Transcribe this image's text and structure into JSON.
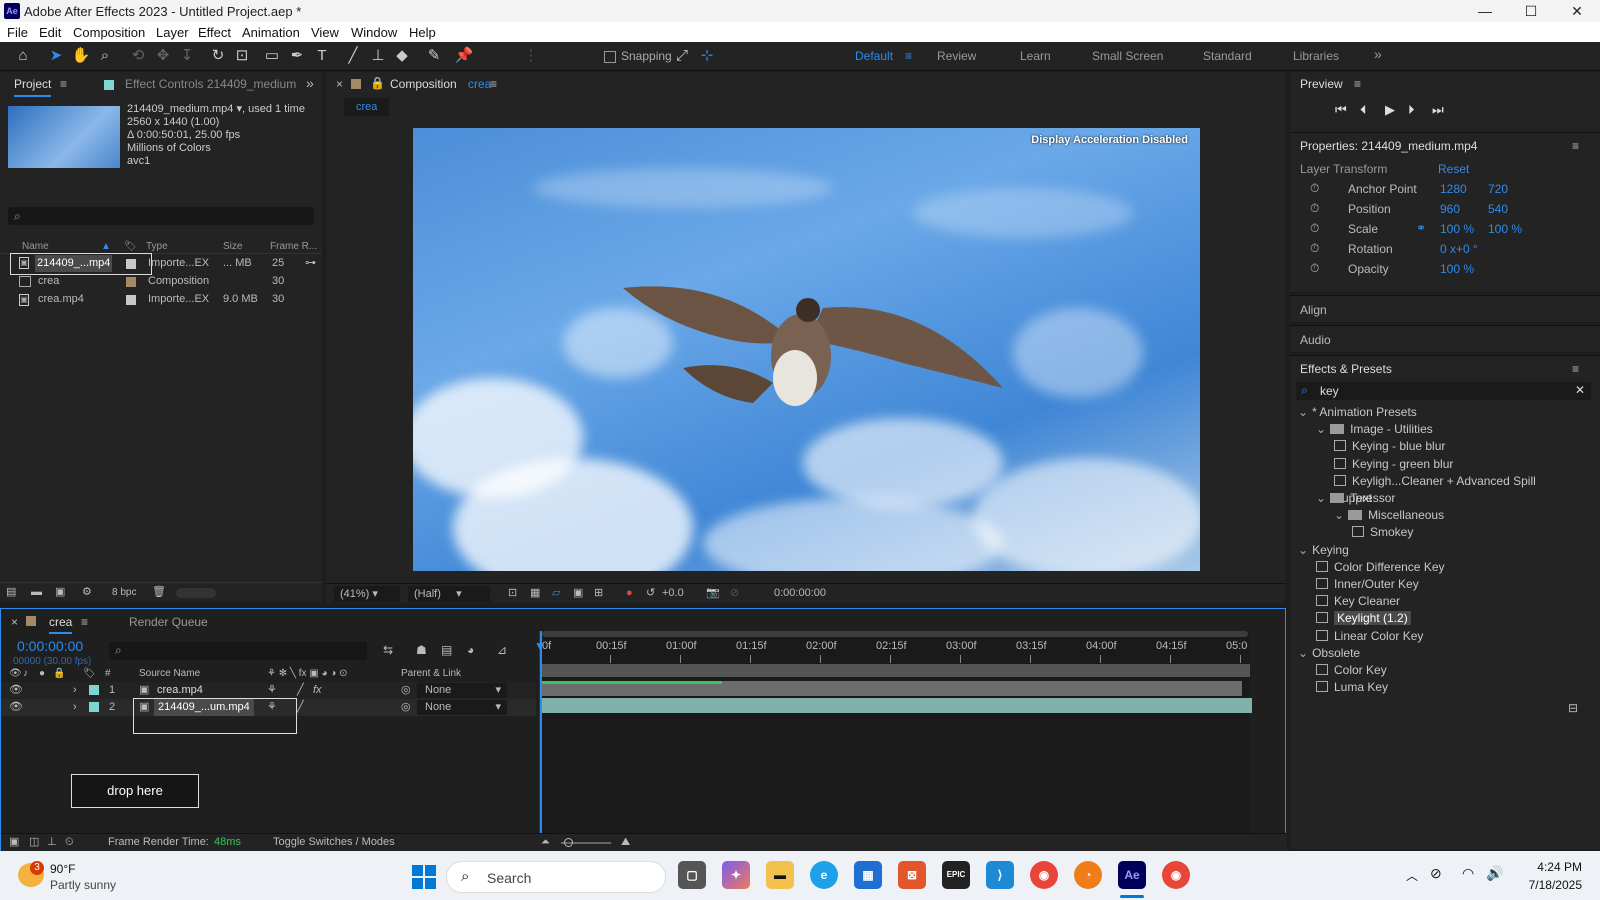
{
  "window": {
    "title": "Adobe After Effects 2023 - Untitled Project.aep *",
    "app_icon": "Ae",
    "minimize": "—",
    "maximize": "☐",
    "close": "✕"
  },
  "menu": [
    "File",
    "Edit",
    "Composition",
    "Layer",
    "Effect",
    "Animation",
    "View",
    "Window",
    "Help"
  ],
  "toolbar": {
    "snapping": "Snapping",
    "workspaces": [
      "Default",
      "Review",
      "Learn",
      "Small Screen",
      "Standard",
      "Libraries"
    ],
    "active_workspace": "Default"
  },
  "project": {
    "tab": "Project",
    "effect_controls_tab": "Effect Controls 214409_medium",
    "selected": {
      "name": "214409_medium.mp4",
      "used": ", used 1 time",
      "res": "2560 x 1440 (1.00)",
      "dur": "Δ 0:00:50:01, 25.00 fps",
      "colors": "Millions of Colors",
      "codec": "avc1"
    },
    "columns": [
      "Name",
      "Type",
      "Size",
      "Frame R..."
    ],
    "items": [
      {
        "name": "214409_...mp4",
        "type": "Importe...EX",
        "size": "... MB",
        "fps": "25",
        "color": "#c8c8c8"
      },
      {
        "name": "crea",
        "type": "Composition",
        "size": "",
        "fps": "30",
        "color": "#a58a6a"
      },
      {
        "name": "crea.mp4",
        "type": "Importe...EX",
        "size": "9.0 MB",
        "fps": "30",
        "color": "#c8c8c8"
      }
    ],
    "bpc": "8 bpc"
  },
  "composition": {
    "tab": "Composition",
    "comp_name": "crea",
    "breadcrumb": "crea",
    "overlay": "Display Acceleration Disabled",
    "zoom": "(41%)",
    "quality": "(Half)",
    "exposure": "+0.0",
    "timecode": "0:00:00:00"
  },
  "preview": {
    "title": "Preview"
  },
  "properties": {
    "title": "Properties: 214409_medium.mp4",
    "section": "Layer Transform",
    "reset": "Reset",
    "rows": [
      {
        "label": "Anchor Point",
        "v1": "1280",
        "v2": "720"
      },
      {
        "label": "Position",
        "v1": "960",
        "v2": "540"
      },
      {
        "label": "Scale",
        "v1": "100 %",
        "v2": "100 %"
      },
      {
        "label": "Rotation",
        "v1": "0 x+0 °",
        "v2": ""
      },
      {
        "label": "Opacity",
        "v1": "100 %",
        "v2": ""
      }
    ]
  },
  "align": "Align",
  "audio": "Audio",
  "effects": {
    "title": "Effects & Presets",
    "search": "key",
    "items": [
      {
        "label": "* Animation Presets",
        "indent": 0,
        "kind": "group"
      },
      {
        "label": "Image - Utilities",
        "indent": 1,
        "kind": "folder"
      },
      {
        "label": "Keying - blue blur",
        "indent": 2,
        "kind": "preset"
      },
      {
        "label": "Keying - green blur",
        "indent": 2,
        "kind": "preset"
      },
      {
        "label": "Keyligh...Cleaner + Advanced Spill Suppressor",
        "indent": 2,
        "kind": "preset"
      },
      {
        "label": "Text",
        "indent": 1,
        "kind": "folder"
      },
      {
        "label": "Miscellaneous",
        "indent": 2,
        "kind": "folder"
      },
      {
        "label": "Smokey",
        "indent": 3,
        "kind": "preset"
      },
      {
        "label": "Keying",
        "indent": 0,
        "kind": "group"
      },
      {
        "label": "Color Difference Key",
        "indent": 1,
        "kind": "effect"
      },
      {
        "label": "Inner/Outer Key",
        "indent": 1,
        "kind": "effect"
      },
      {
        "label": "Key Cleaner",
        "indent": 1,
        "kind": "effect"
      },
      {
        "label": "Keylight (1.2)",
        "indent": 1,
        "kind": "effect",
        "selected": true
      },
      {
        "label": "Linear Color Key",
        "indent": 1,
        "kind": "effect"
      },
      {
        "label": "Obsolete",
        "indent": 0,
        "kind": "group"
      },
      {
        "label": "Color Key",
        "indent": 1,
        "kind": "effect"
      },
      {
        "label": "Luma Key",
        "indent": 1,
        "kind": "effect"
      }
    ]
  },
  "timeline": {
    "comp_tab": "crea",
    "render_queue": "Render Queue",
    "timecode": "0:00:00:00",
    "sub_timecode": "00000 (30.00 fps)",
    "cols": {
      "num": "#",
      "source": "Source Name",
      "parent": "Parent & Link"
    },
    "layers": [
      {
        "num": "1",
        "name": "crea.mp4",
        "parent": "None"
      },
      {
        "num": "2",
        "name": "214409_...um.mp4",
        "parent": "None"
      }
    ],
    "ruler": [
      "0f",
      "00:15f",
      "01:00f",
      "01:15f",
      "02:00f",
      "02:15f",
      "03:00f",
      "03:15f",
      "04:00f",
      "04:15f",
      "05:0"
    ],
    "drop": "drop here",
    "render_time_label": "Frame Render Time:",
    "render_time": "48ms",
    "toggle": "Toggle Switches / Modes"
  },
  "taskbar": {
    "badge": "3",
    "temp": "90°F",
    "weather": "Partly sunny",
    "search": "Search",
    "time": "4:24 PM",
    "date": "7/18/2025"
  }
}
